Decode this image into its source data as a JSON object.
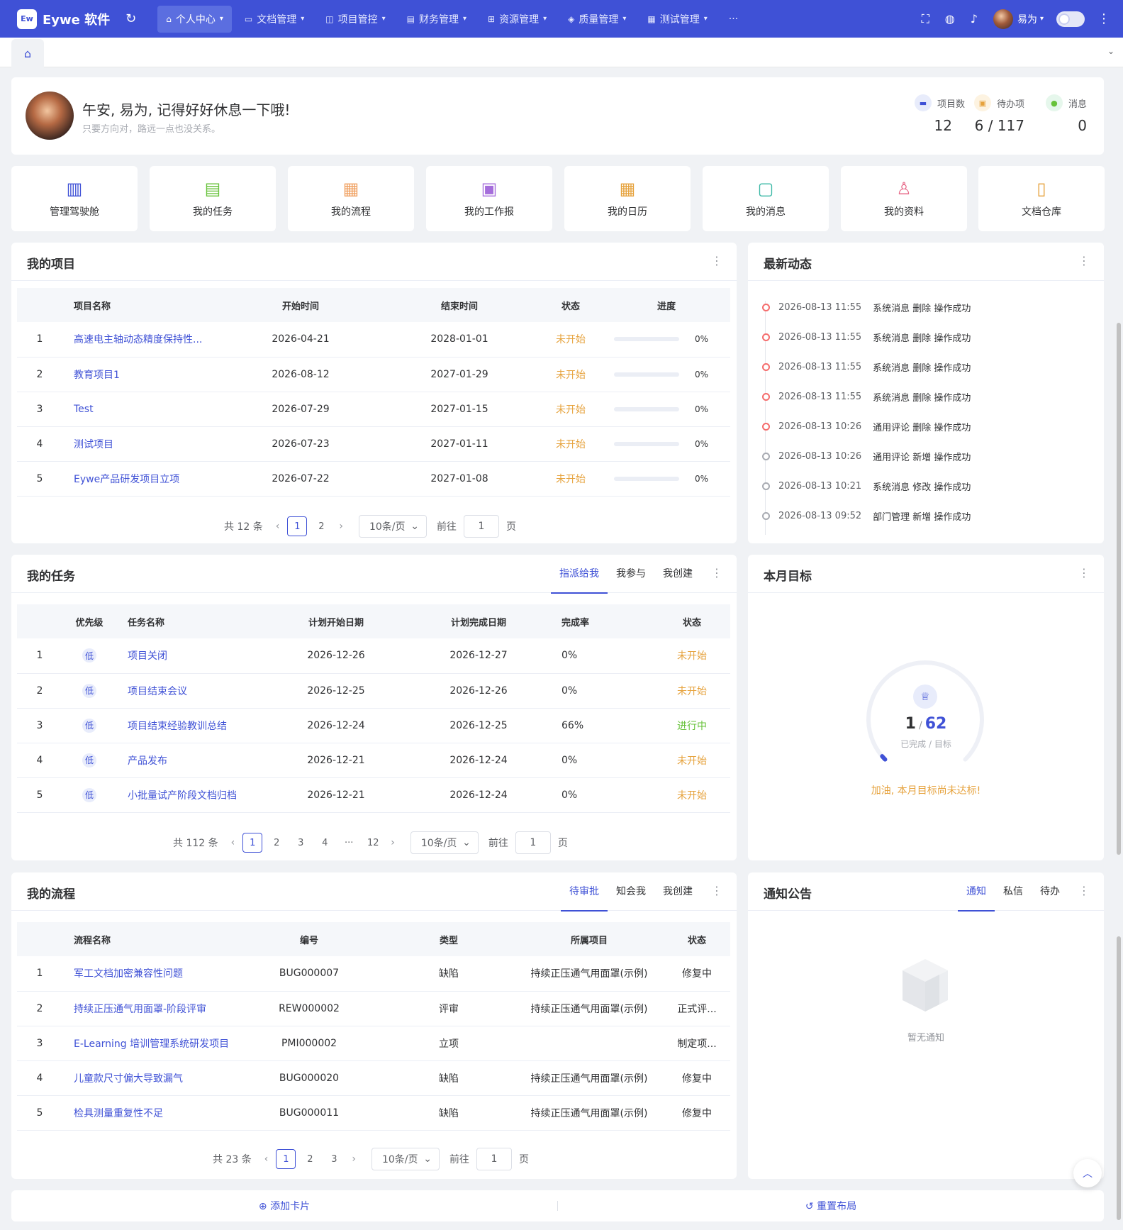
{
  "topbar": {
    "logo_mark": "Ew",
    "app_name": "Eywe 软件",
    "nav": [
      {
        "label": "个人中心",
        "icon": "home-icon"
      },
      {
        "label": "文档管理",
        "icon": "folder-icon"
      },
      {
        "label": "项目管控",
        "icon": "presentation-icon"
      },
      {
        "label": "财务管理",
        "icon": "finance-icon"
      },
      {
        "label": "资源管理",
        "icon": "org-icon"
      },
      {
        "label": "质量管理",
        "icon": "shield-icon"
      },
      {
        "label": "测试管理",
        "icon": "test-icon"
      }
    ],
    "more": "···",
    "user_name": "易为",
    "brand_color": "#3f51d6"
  },
  "welcome": {
    "title": "午安, 易为, 记得好好休息一下哦!",
    "subtitle": "只要方向对，路远一点也没关系。",
    "stats": [
      {
        "label": "项目数",
        "value": "12"
      },
      {
        "label": "待办项",
        "value": "6 / 117"
      },
      {
        "label": "消息",
        "value": "0"
      }
    ]
  },
  "shortcuts": [
    {
      "label": "管理驾驶舱",
      "icon": "dashboard-icon"
    },
    {
      "label": "我的任务",
      "icon": "document-icon"
    },
    {
      "label": "我的流程",
      "icon": "grid-icon"
    },
    {
      "label": "我的工作报",
      "icon": "calendar-icon"
    },
    {
      "label": "我的日历",
      "icon": "calendar-grid-icon"
    },
    {
      "label": "我的消息",
      "icon": "message-icon"
    },
    {
      "label": "我的资料",
      "icon": "user-icon"
    },
    {
      "label": "文档仓库",
      "icon": "book-icon"
    }
  ],
  "projects": {
    "title": "我的项目",
    "headers": [
      "项目名称",
      "开始时间",
      "结束时间",
      "状态",
      "进度"
    ],
    "rows": [
      {
        "no": "1",
        "name": "高速电主轴动态精度保持性...",
        "start": "2026-04-21",
        "end": "2028-01-01",
        "status": "未开始",
        "progress": "0%"
      },
      {
        "no": "2",
        "name": "教育项目1",
        "start": "2026-08-12",
        "end": "2027-01-29",
        "status": "未开始",
        "progress": "0%"
      },
      {
        "no": "3",
        "name": "Test",
        "start": "2026-07-29",
        "end": "2027-01-15",
        "status": "未开始",
        "progress": "0%"
      },
      {
        "no": "4",
        "name": "测试项目",
        "start": "2026-07-23",
        "end": "2027-01-11",
        "status": "未开始",
        "progress": "0%"
      },
      {
        "no": "5",
        "name": "Eywe产品研发项目立项",
        "start": "2026-07-22",
        "end": "2027-01-08",
        "status": "未开始",
        "progress": "0%"
      }
    ],
    "pager": {
      "total": "共 12 条",
      "pages": [
        "1",
        "2"
      ],
      "size": "10条/页",
      "goto": "前往",
      "page_input": "1",
      "page_unit": "页"
    }
  },
  "activity": {
    "title": "最新动态",
    "items": [
      {
        "time": "2026-08-13 11:55",
        "text": "系统消息 删除 操作成功",
        "color": "red"
      },
      {
        "time": "2026-08-13 11:55",
        "text": "系统消息 删除 操作成功",
        "color": "red"
      },
      {
        "time": "2026-08-13 11:55",
        "text": "系统消息 删除 操作成功",
        "color": "red"
      },
      {
        "time": "2026-08-13 11:55",
        "text": "系统消息 删除 操作成功",
        "color": "red"
      },
      {
        "time": "2026-08-13 10:26",
        "text": "通用评论 删除 操作成功",
        "color": "red"
      },
      {
        "time": "2026-08-13 10:26",
        "text": "通用评论 新增 操作成功",
        "color": "gray"
      },
      {
        "time": "2026-08-13 10:21",
        "text": "系统消息 修改 操作成功",
        "color": "gray"
      },
      {
        "time": "2026-08-13 09:52",
        "text": "部门管理 新增 操作成功",
        "color": "gray"
      }
    ]
  },
  "tasks": {
    "title": "我的任务",
    "tabs": [
      "指派给我",
      "我参与",
      "我创建"
    ],
    "headers": [
      "优先级",
      "任务名称",
      "计划开始日期",
      "计划完成日期",
      "完成率",
      "状态"
    ],
    "rows": [
      {
        "no": "1",
        "prio": "低",
        "name": "项目关闭",
        "start": "2026-12-26",
        "end": "2026-12-27",
        "rate": "0%",
        "status": "未开始"
      },
      {
        "no": "2",
        "prio": "低",
        "name": "项目结束会议",
        "start": "2026-12-25",
        "end": "2026-12-26",
        "rate": "0%",
        "status": "未开始"
      },
      {
        "no": "3",
        "prio": "低",
        "name": "项目结束经验教训总结",
        "start": "2026-12-24",
        "end": "2026-12-25",
        "rate": "66%",
        "status": "进行中"
      },
      {
        "no": "4",
        "prio": "低",
        "name": "产品发布",
        "start": "2026-12-21",
        "end": "2026-12-24",
        "rate": "0%",
        "status": "未开始"
      },
      {
        "no": "5",
        "prio": "低",
        "name": "小批量试产阶段文档归档",
        "start": "2026-12-21",
        "end": "2026-12-24",
        "rate": "0%",
        "status": "未开始"
      }
    ],
    "pager": {
      "total": "共 112 条",
      "pages": [
        "1",
        "2",
        "3",
        "4",
        "···",
        "12"
      ],
      "size": "10条/页",
      "goto": "前往",
      "page_input": "1",
      "page_unit": "页"
    }
  },
  "goal": {
    "title": "本月目标",
    "done": "1",
    "target": "62",
    "fraction": 0.016,
    "sub": "已完成 / 目标",
    "tip": "加油, 本月目标尚未达标!"
  },
  "flows": {
    "title": "我的流程",
    "tabs": [
      "待审批",
      "知会我",
      "我创建"
    ],
    "headers": [
      "流程名称",
      "编号",
      "类型",
      "所属项目",
      "状态"
    ],
    "rows": [
      {
        "no": "1",
        "name": "军工文档加密兼容性问题",
        "code": "BUG000007",
        "type": "缺陷",
        "project": "持续正压通气用面罩(示例)",
        "status": "修复中"
      },
      {
        "no": "2",
        "name": "持续正压通气用面罩-阶段评审",
        "code": "REW000002",
        "type": "评审",
        "project": "持续正压通气用面罩(示例)",
        "status": "正式评..."
      },
      {
        "no": "3",
        "name": "E-Learning 培训管理系统研发项目",
        "code": "PMI000002",
        "type": "立项",
        "project": "",
        "status": "制定项..."
      },
      {
        "no": "4",
        "name": "儿童款尺寸偏大导致漏气",
        "code": "BUG000020",
        "type": "缺陷",
        "project": "持续正压通气用面罩(示例)",
        "status": "修复中"
      },
      {
        "no": "5",
        "name": "检具测量重复性不足",
        "code": "BUG000011",
        "type": "缺陷",
        "project": "持续正压通气用面罩(示例)",
        "status": "修复中"
      }
    ],
    "pager": {
      "total": "共 23 条",
      "pages": [
        "1",
        "2",
        "3"
      ],
      "size": "10条/页",
      "goto": "前往",
      "page_input": "1",
      "page_unit": "页"
    }
  },
  "notice": {
    "title": "通知公告",
    "tabs": [
      "通知",
      "私信",
      "待办"
    ],
    "empty": "暂无通知"
  },
  "bottom": {
    "add": "添加卡片",
    "reset": "重置布局"
  }
}
